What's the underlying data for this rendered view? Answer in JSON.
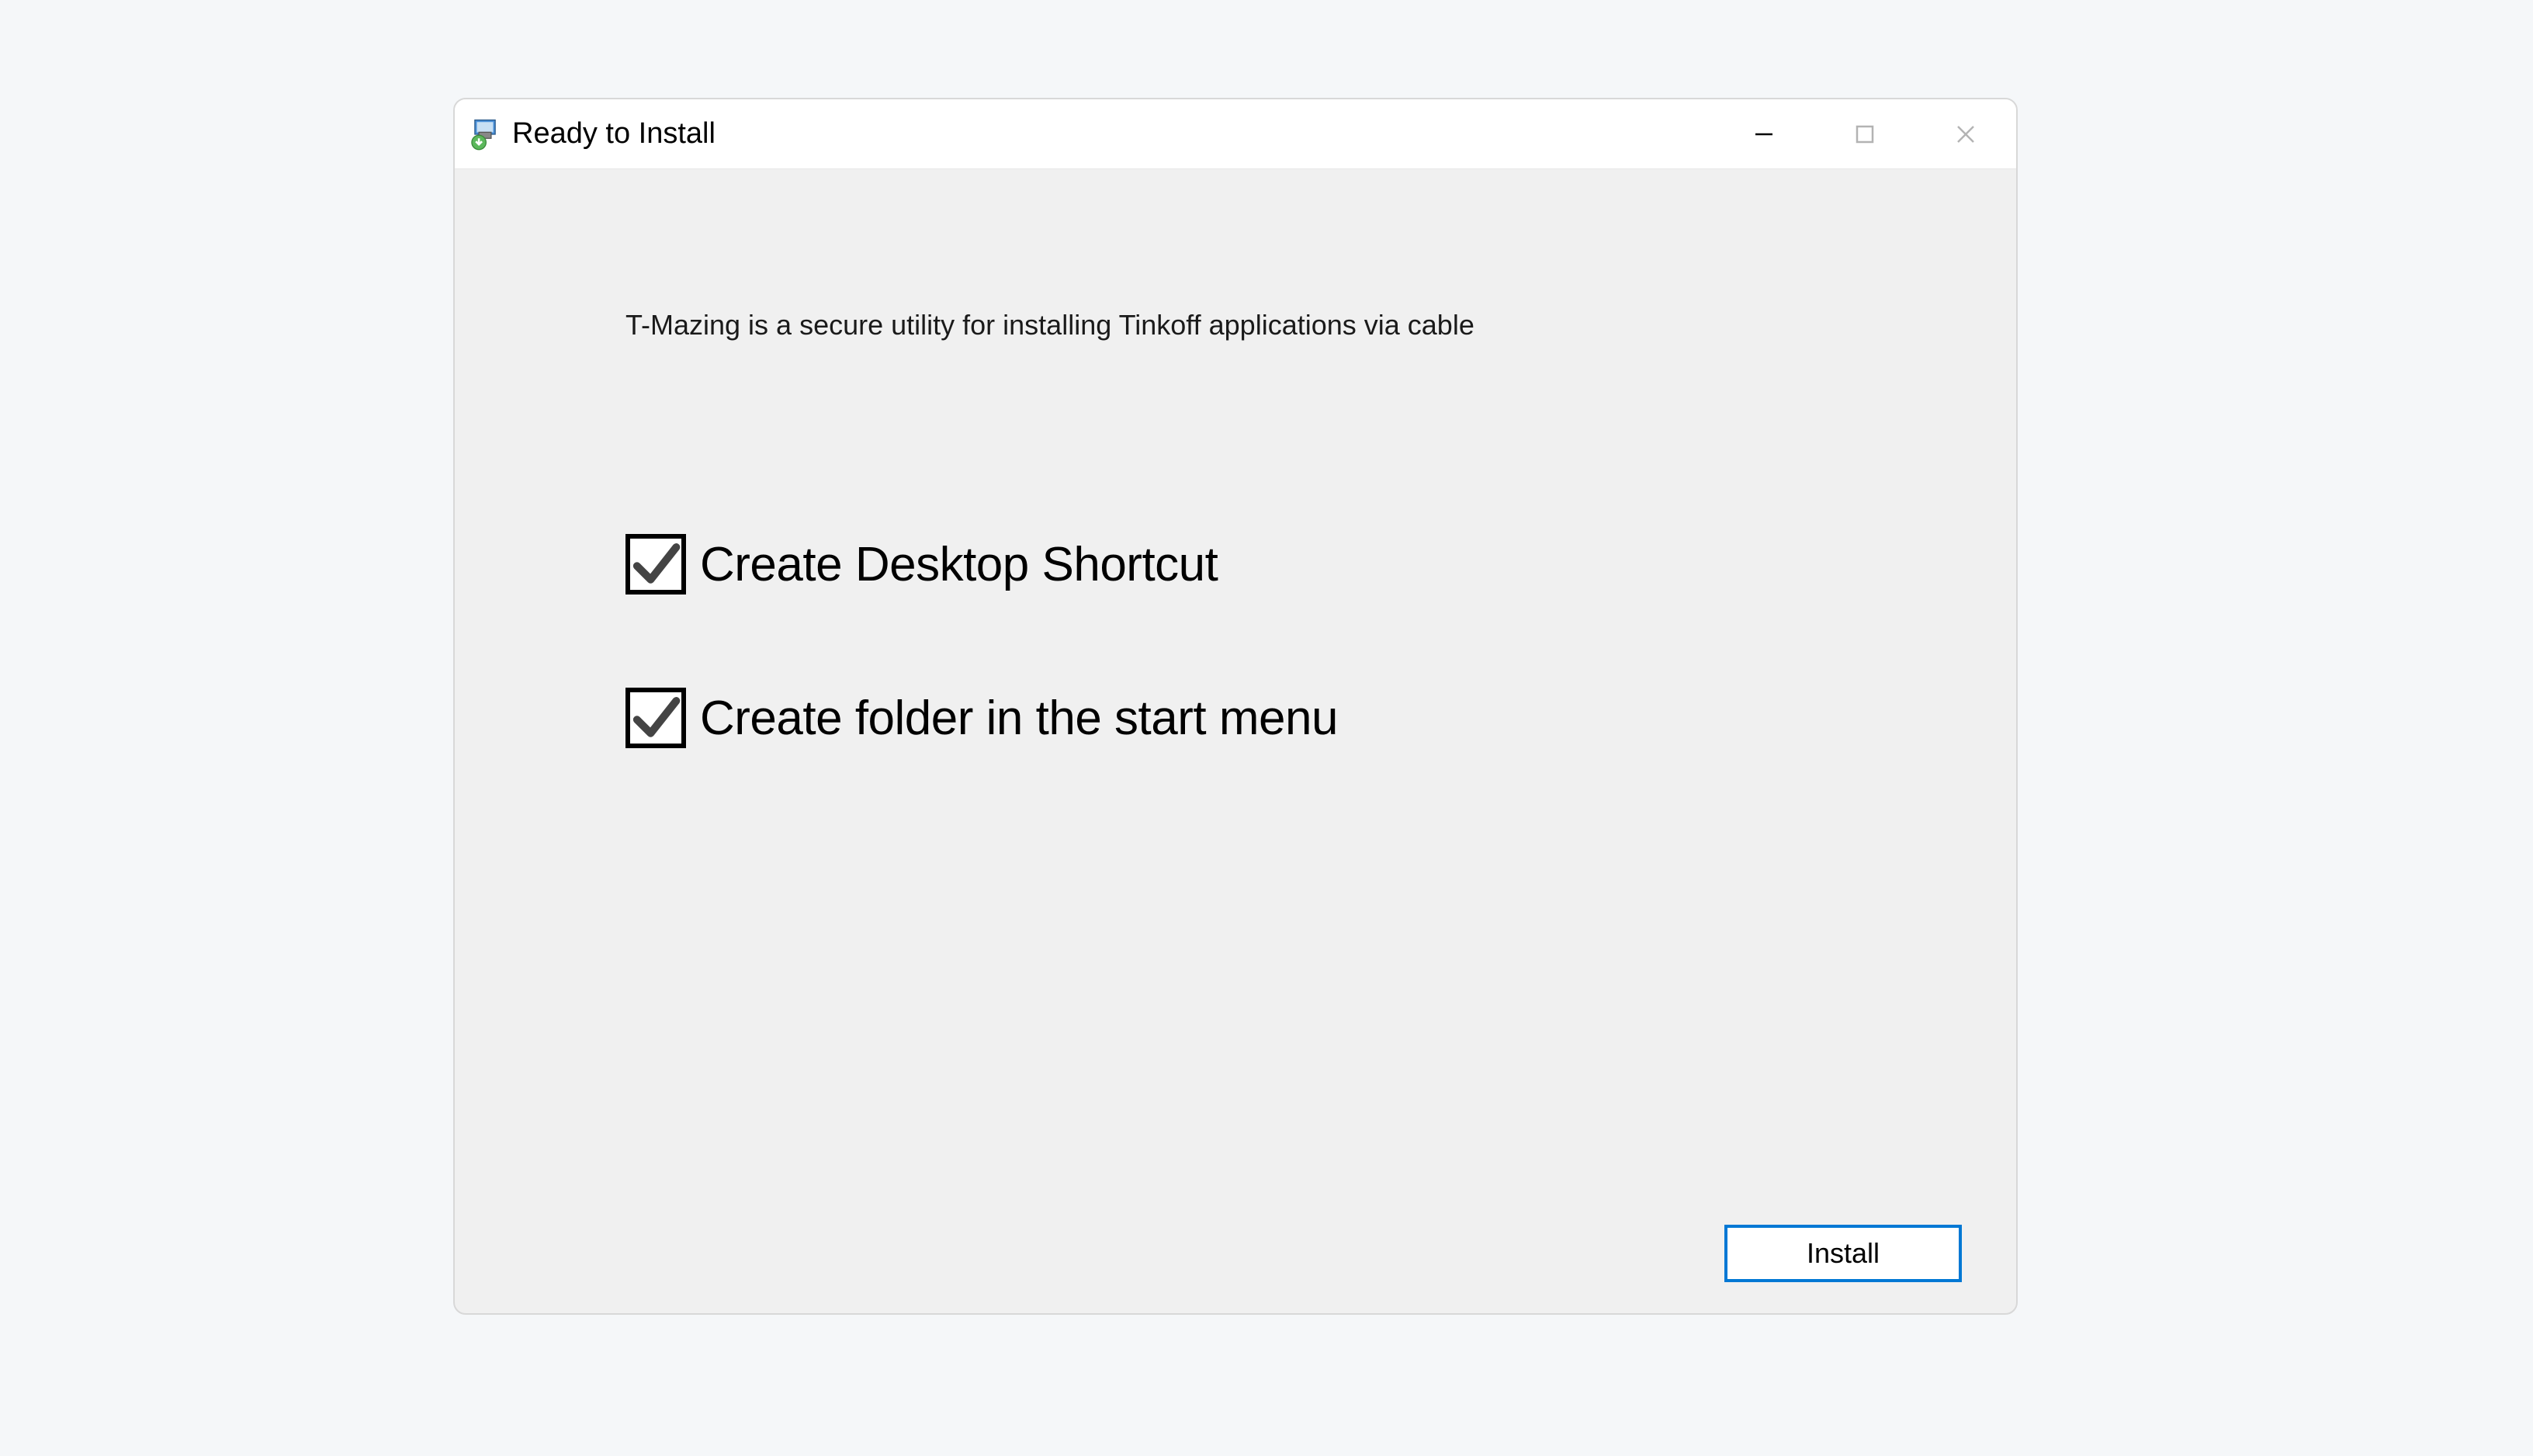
{
  "window": {
    "title": "Ready to Install"
  },
  "content": {
    "description": "T-Mazing is a secure utility for installing Tinkoff applications via cable"
  },
  "options": [
    {
      "label": "Create Desktop Shortcut",
      "checked": true
    },
    {
      "label": "Create folder in the start menu",
      "checked": true
    }
  ],
  "buttons": {
    "install": "Install"
  }
}
